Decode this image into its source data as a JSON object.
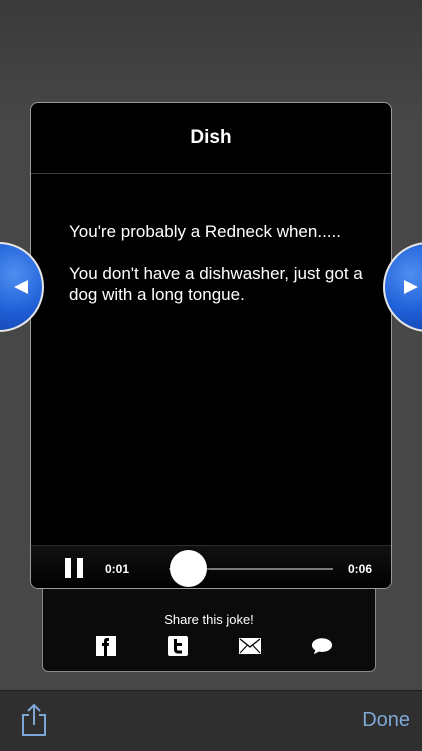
{
  "card": {
    "title": "Dish",
    "joke_line1": "You're probably a Redneck when.....",
    "joke_line2": "You don't have a dishwasher, just got a dog with a long tongue."
  },
  "player": {
    "current_time": "0:01",
    "duration": "0:06",
    "progress": 0.17
  },
  "share": {
    "title": "Share this joke!",
    "icons": [
      "facebook-icon",
      "twitter-icon",
      "email-icon",
      "message-icon"
    ]
  },
  "toolbar": {
    "done_label": "Done"
  },
  "colors": {
    "accent_blue": "#1f5fd8",
    "done_text": "#7ea7d6",
    "background": "#474747"
  }
}
